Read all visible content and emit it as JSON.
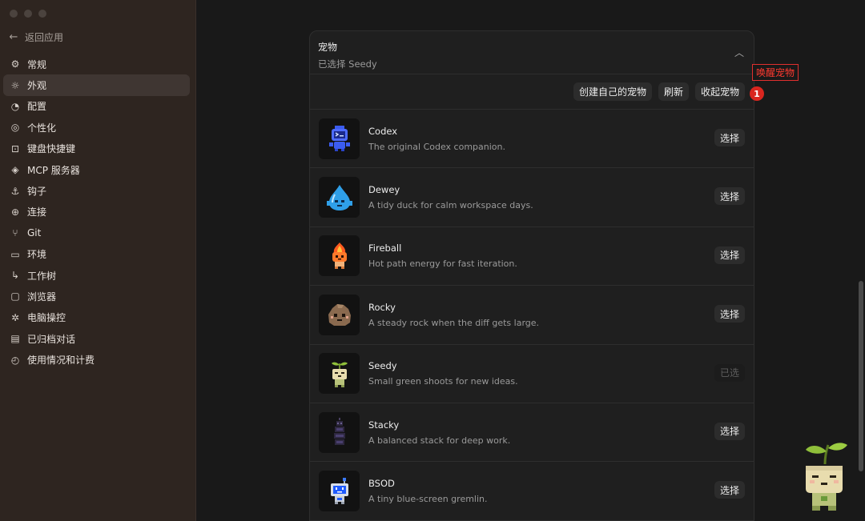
{
  "sidebar": {
    "back_label": "返回应用",
    "items": [
      {
        "label": "常规",
        "icon": "gear-icon"
      },
      {
        "label": "外观",
        "icon": "sun-icon"
      },
      {
        "label": "配置",
        "icon": "config-icon"
      },
      {
        "label": "个性化",
        "icon": "personalize-icon"
      },
      {
        "label": "键盘快捷键",
        "icon": "keyboard-icon"
      },
      {
        "label": "MCP 服务器",
        "icon": "mcp-icon"
      },
      {
        "label": "钩子",
        "icon": "anchor-icon"
      },
      {
        "label": "连接",
        "icon": "globe-icon"
      },
      {
        "label": "Git",
        "icon": "git-branch-icon"
      },
      {
        "label": "环境",
        "icon": "monitor-icon"
      },
      {
        "label": "工作树",
        "icon": "worktree-icon"
      },
      {
        "label": "浏览器",
        "icon": "browser-icon"
      },
      {
        "label": "电脑操控",
        "icon": "sparkle-icon"
      },
      {
        "label": "已归档对话",
        "icon": "archive-icon"
      },
      {
        "label": "使用情况和计费",
        "icon": "gauge-icon"
      }
    ],
    "active_index": 1
  },
  "panel": {
    "title": "宠物",
    "subtitle": "已选择 Seedy",
    "toolbar": {
      "create": "创建自己的宠物",
      "refresh": "刷新",
      "collapse": "收起宠物"
    },
    "pets": [
      {
        "name": "Codex",
        "desc": "The original Codex companion.",
        "action": "选择",
        "selected": false
      },
      {
        "name": "Dewey",
        "desc": "A tidy duck for calm workspace days.",
        "action": "选择",
        "selected": false
      },
      {
        "name": "Fireball",
        "desc": "Hot path energy for fast iteration.",
        "action": "选择",
        "selected": false
      },
      {
        "name": "Rocky",
        "desc": "A steady rock when the diff gets large.",
        "action": "选择",
        "selected": false
      },
      {
        "name": "Seedy",
        "desc": "Small green shoots for new ideas.",
        "action": "已选",
        "selected": true
      },
      {
        "name": "Stacky",
        "desc": "A balanced stack for deep work.",
        "action": "选择",
        "selected": false
      },
      {
        "name": "BSOD",
        "desc": "A tiny blue-screen gremlin.",
        "action": "选择",
        "selected": false
      }
    ]
  },
  "annotation": {
    "label": "唤醒宠物",
    "number": "1",
    "color": "#e0302e"
  }
}
